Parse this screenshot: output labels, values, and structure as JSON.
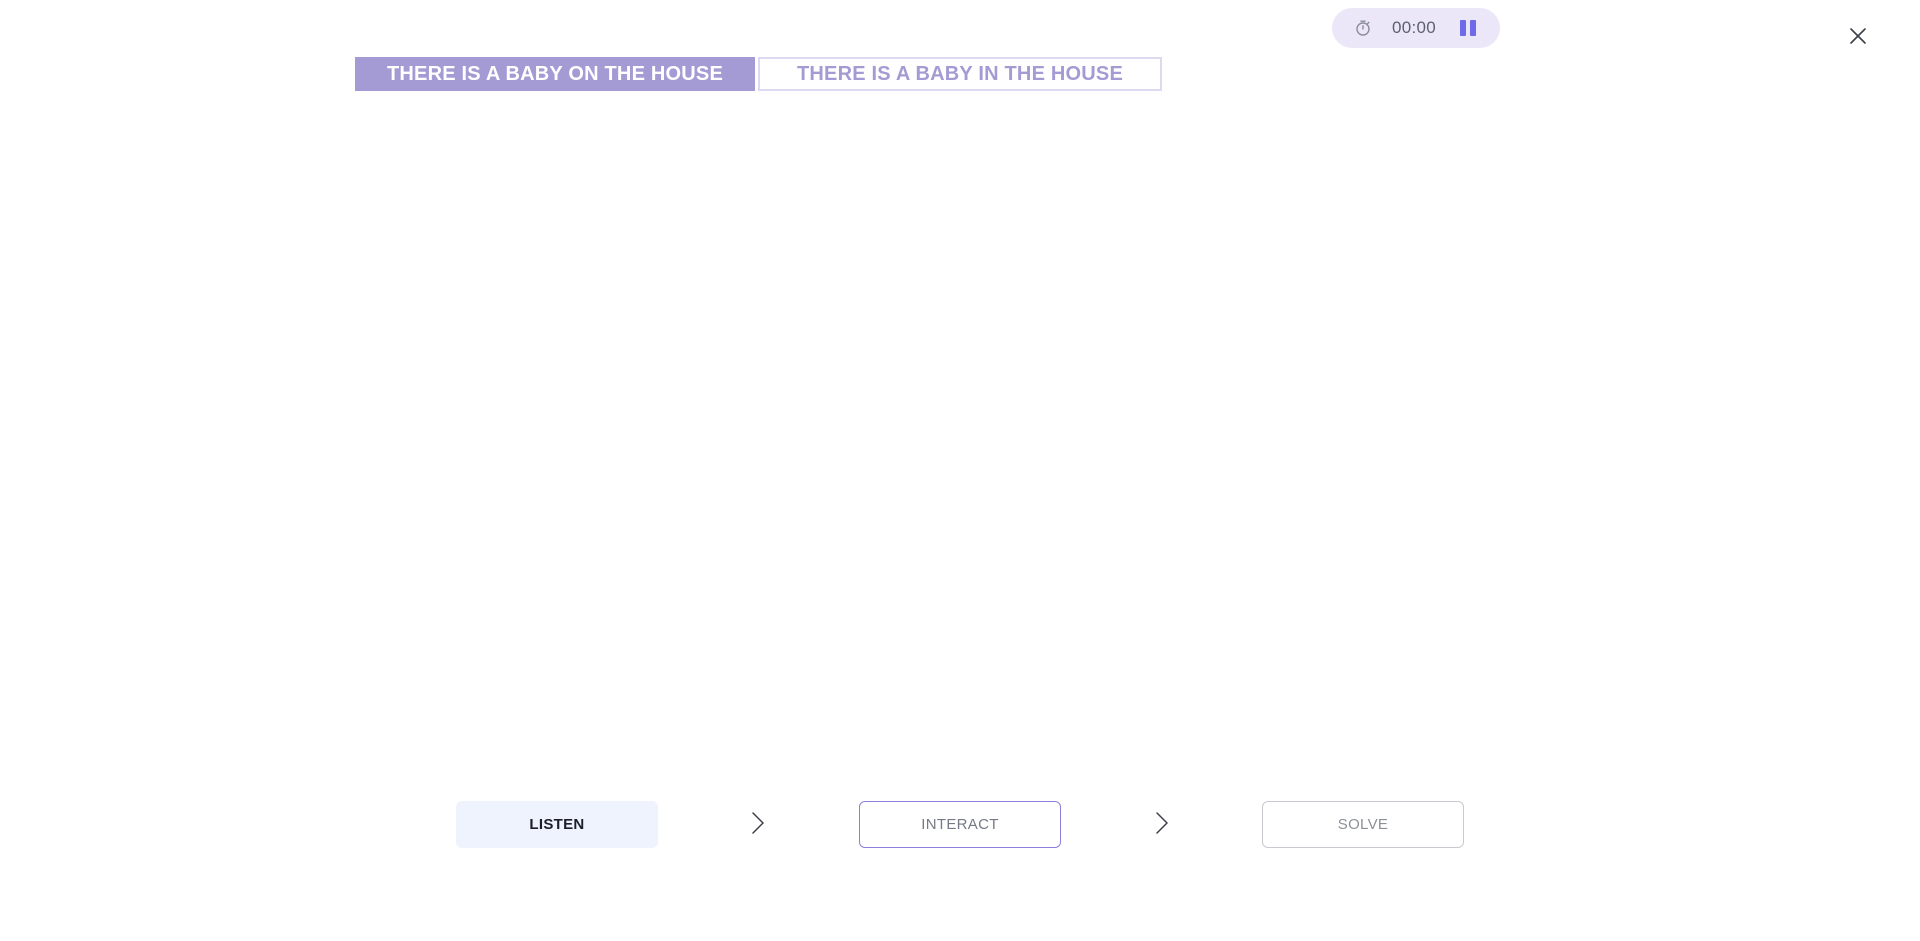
{
  "timer": {
    "time": "00:00",
    "clock_icon": "stopwatch-icon",
    "pause_icon": "pause-icon",
    "accent": "#6f6ae8",
    "background": "#ebe7f8"
  },
  "close_icon": "close-icon",
  "options": [
    {
      "label": "THERE IS A BABY ON THE HOUSE",
      "selected": true
    },
    {
      "label": "THERE IS A BABY IN THE HOUSE",
      "selected": false
    }
  ],
  "steps": {
    "listen": "LISTEN",
    "interact": "INTERACT",
    "solve": "SOLVE",
    "separator_icon": "chevron-right-icon"
  },
  "colors": {
    "selected_option": "#a49bd4",
    "unselected_option_border": "#ddd9f0",
    "active_step_background": "#eef3fd",
    "interact_border": "#8f7fdc"
  }
}
